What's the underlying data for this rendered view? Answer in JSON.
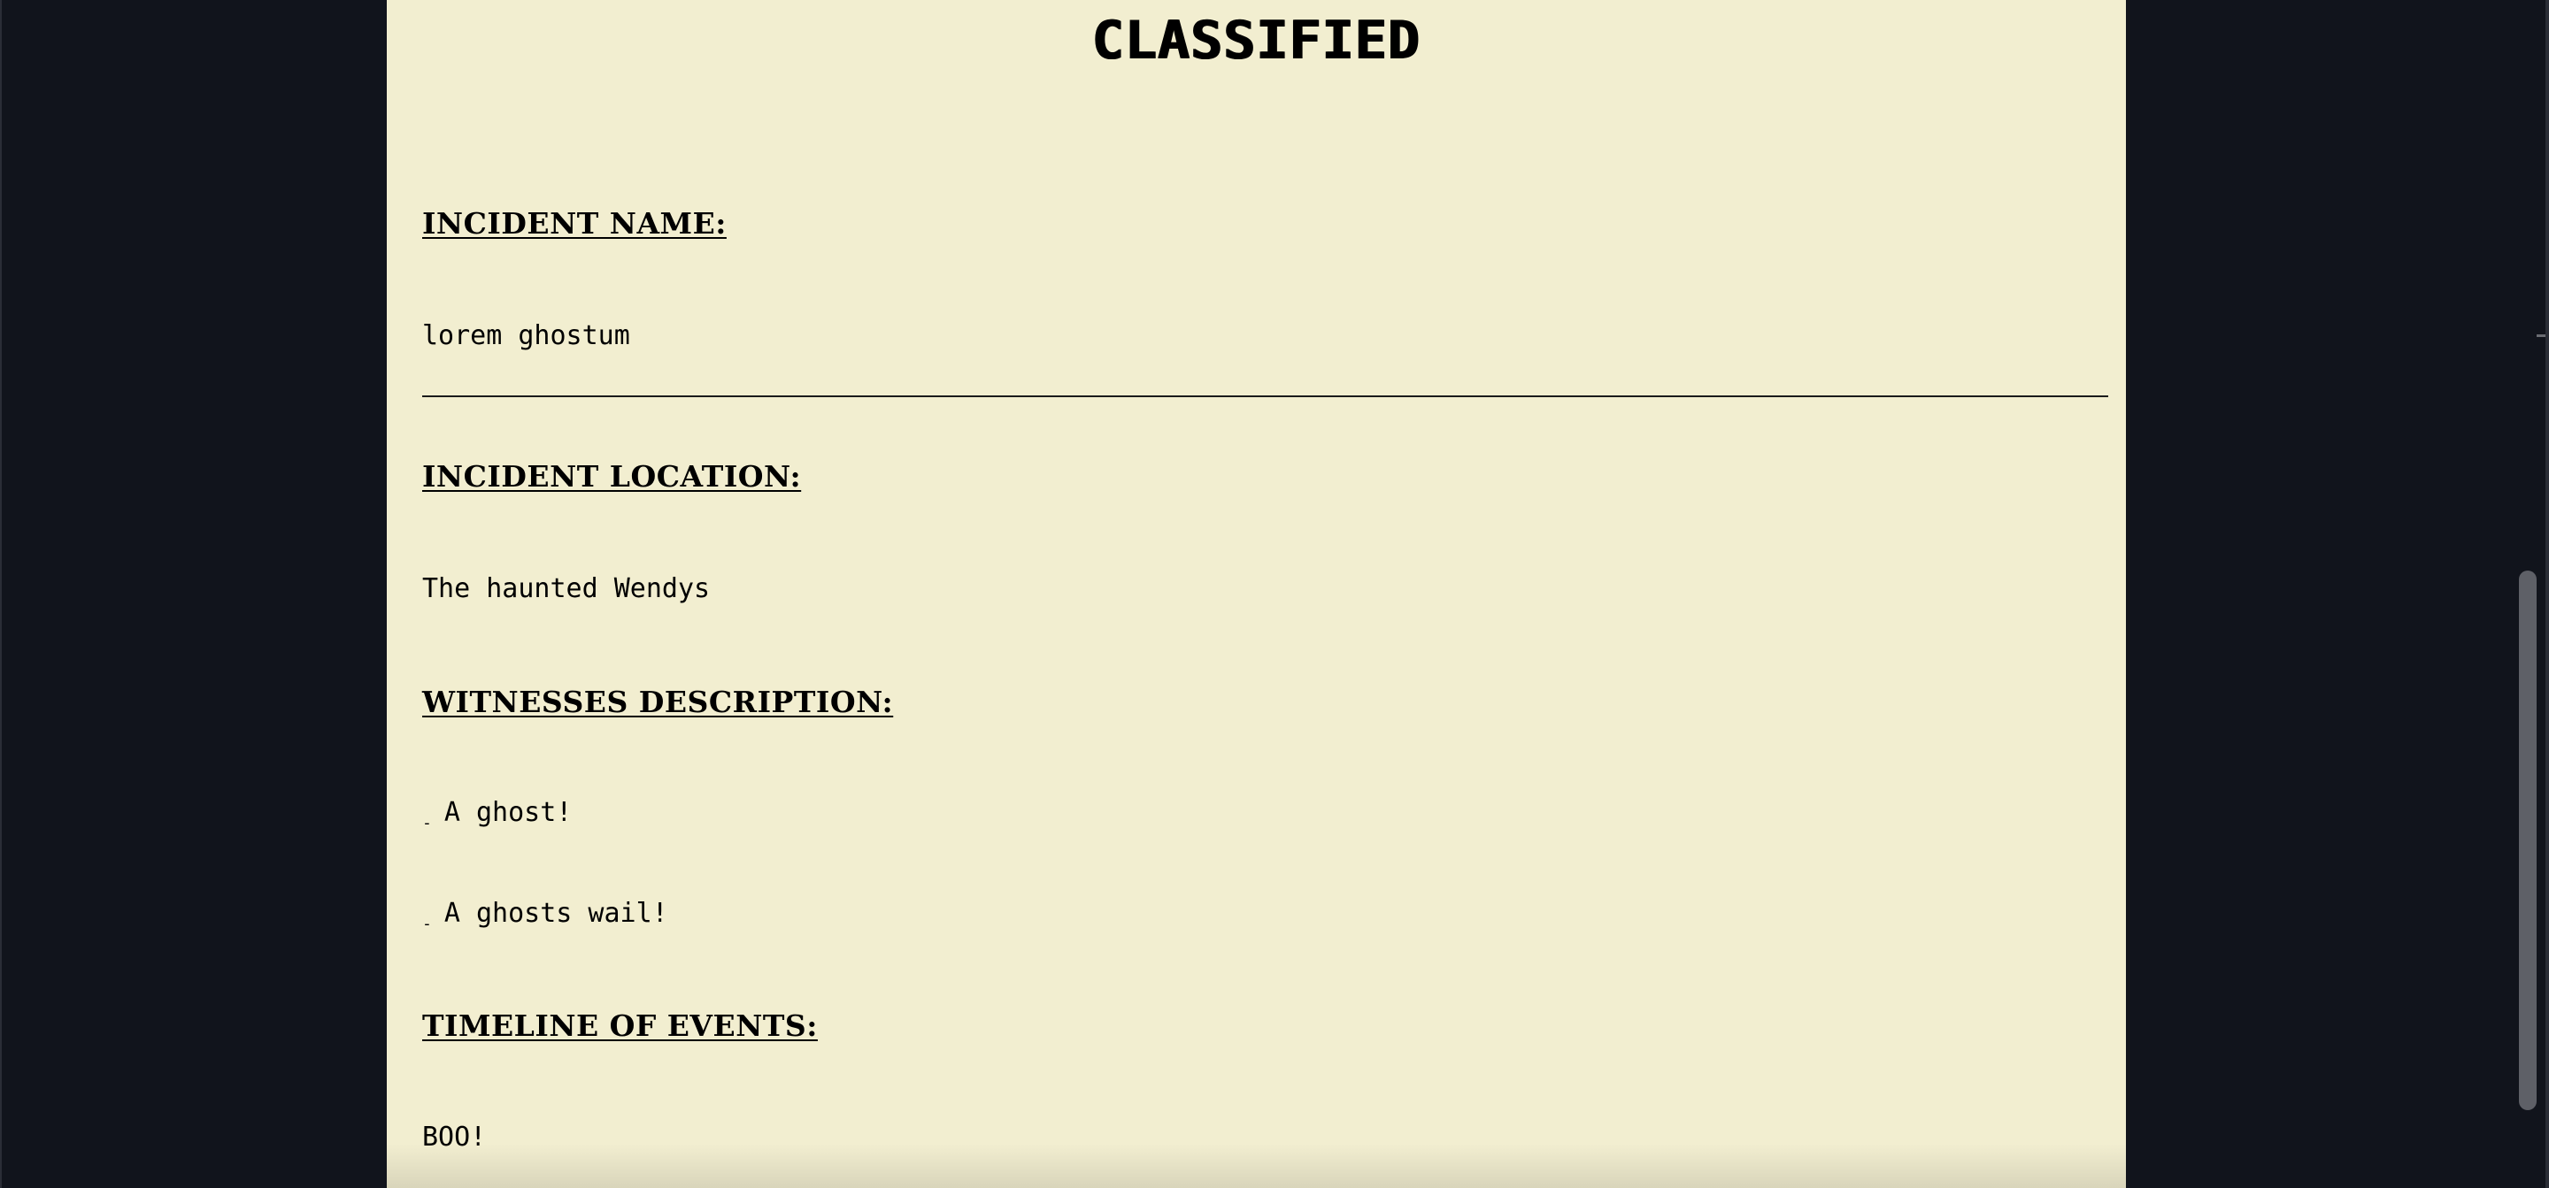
{
  "report": {
    "title": "CLASSIFIED",
    "incident_name": {
      "heading": "INCIDENT NAME:",
      "value": "lorem ghostum"
    },
    "incident_location": {
      "heading": "INCIDENT LOCATION:",
      "value": "The haunted Wendys"
    },
    "witnesses_description": {
      "heading": "WITNESSES DESCRIPTION:",
      "bullet_symbol": "-",
      "items": [
        "A ghost!",
        "A ghosts wail!"
      ]
    },
    "timeline_of_events": {
      "heading": "TIMELINE OF EVENTS:",
      "value": "BOO!"
    }
  },
  "colors": {
    "page_background": "#11141c",
    "paper": "#f2eed0",
    "ink": "#000000",
    "scrollbar_thumb": "#5e6067"
  }
}
